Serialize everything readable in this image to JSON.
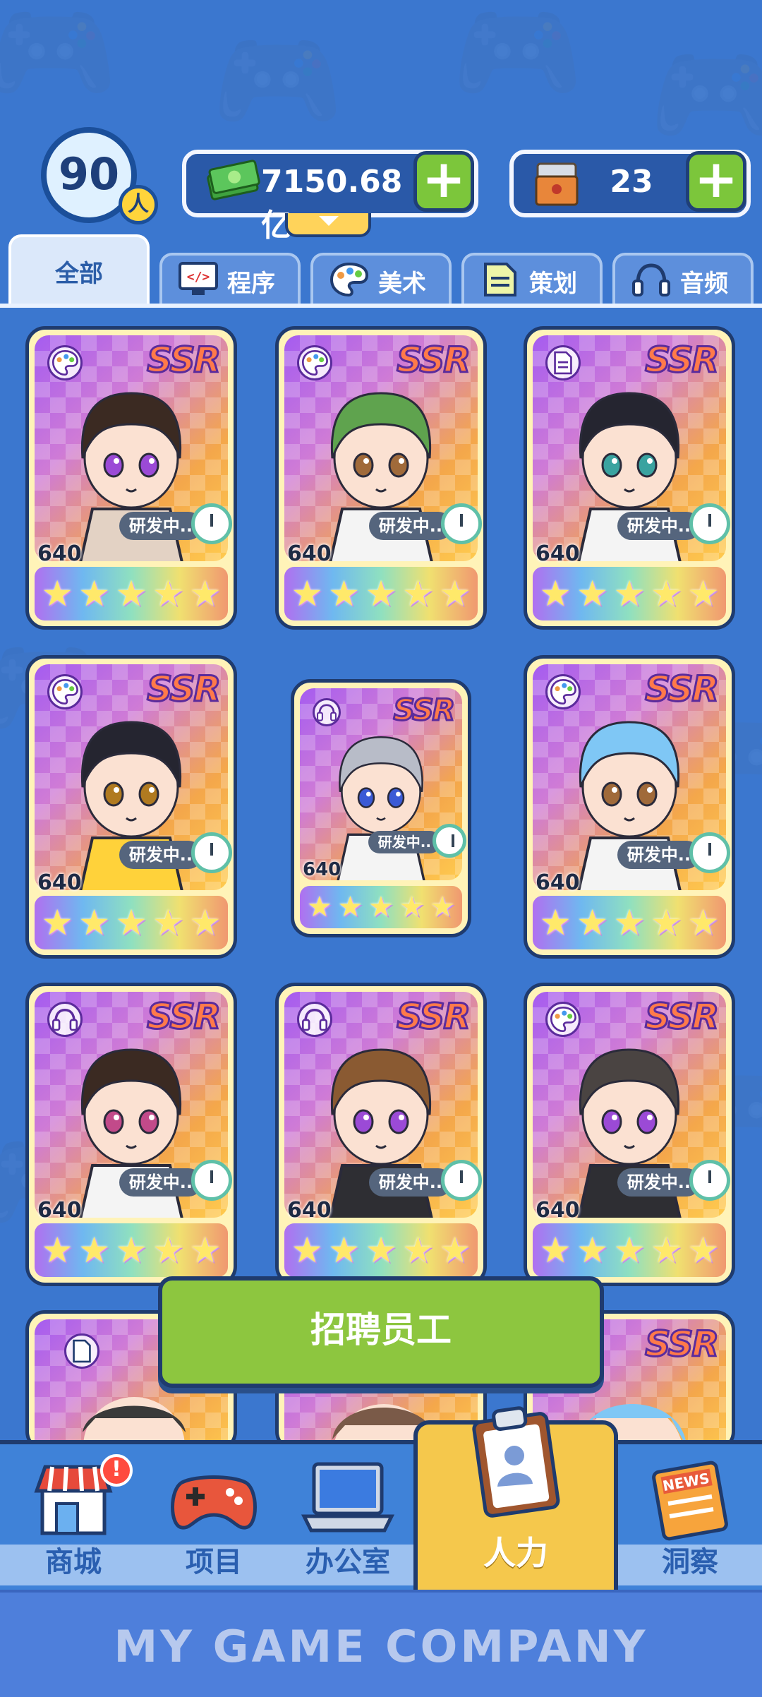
{
  "hud": {
    "staff_count": "90",
    "staff_unit": "人",
    "money": "7150.68亿",
    "mail_count": "23",
    "plus": "+"
  },
  "tabs": [
    {
      "label": "全部",
      "icon": "all"
    },
    {
      "label": "程序",
      "icon": "code-icon"
    },
    {
      "label": "美术",
      "icon": "palette-icon"
    },
    {
      "label": "策划",
      "icon": "document-icon"
    },
    {
      "label": "音频",
      "icon": "headphones-icon"
    }
  ],
  "cards": [
    {
      "rarity": "SSR",
      "type": "palette-icon",
      "status": "研发中..",
      "level": "640",
      "stars": "★★★★★"
    },
    {
      "rarity": "SSR",
      "type": "palette-icon",
      "status": "研发中..",
      "level": "640",
      "stars": "★★★★★"
    },
    {
      "rarity": "SSR",
      "type": "document-icon",
      "status": "研发中..",
      "level": "640",
      "stars": "★★★★★"
    },
    {
      "rarity": "SSR",
      "type": "palette-icon",
      "status": "研发中..",
      "level": "640",
      "stars": "★★★★★"
    },
    {
      "rarity": "SSR",
      "type": "headphones-icon",
      "status": "研发中..",
      "level": "640",
      "stars": "★★★★★"
    },
    {
      "rarity": "SSR",
      "type": "palette-icon",
      "status": "研发中..",
      "level": "640",
      "stars": "★★★★★"
    },
    {
      "rarity": "SSR",
      "type": "headphones-icon",
      "status": "研发中..",
      "level": "640",
      "stars": "★★★★★"
    },
    {
      "rarity": "SSR",
      "type": "headphones-icon",
      "status": "研发中..",
      "level": "640",
      "stars": "★★★★★"
    },
    {
      "rarity": "SSR",
      "type": "palette-icon",
      "status": "研发中..",
      "level": "640",
      "stars": "★★★★★"
    }
  ],
  "partial_cards": [
    {
      "rarity": "",
      "type": "document-icon"
    },
    {
      "rarity": "",
      "type": ""
    },
    {
      "rarity": "SSR",
      "type": ""
    }
  ],
  "recruit_label": "招聘员工",
  "nav": [
    {
      "label": "商城",
      "icon": "shop-icon",
      "alert": "!"
    },
    {
      "label": "项目",
      "icon": "gamepad-icon"
    },
    {
      "label": "办公室",
      "icon": "laptop-icon"
    },
    {
      "label": "人力",
      "icon": "clipboard-icon"
    },
    {
      "label": "洞察",
      "icon": "news-icon",
      "badge": "NEWS"
    }
  ],
  "footer_title": "MY GAME COMPANY",
  "colors": {
    "background": "#3b77cf",
    "recruit_button": "#8dc63f",
    "active_nav": "#f5c84c",
    "ssr_text": "#ff7a4a"
  }
}
